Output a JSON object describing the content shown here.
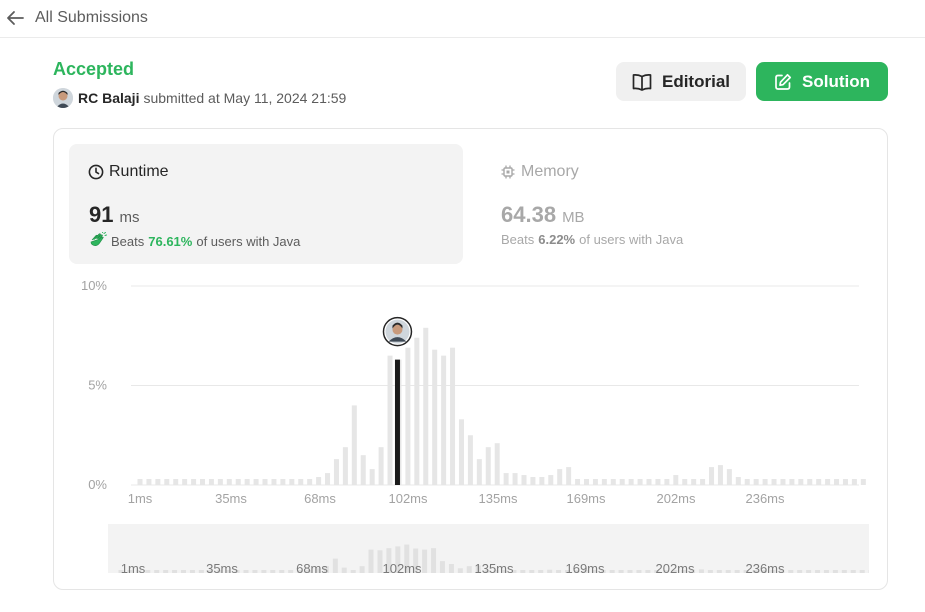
{
  "nav": {
    "back_label": "All Submissions"
  },
  "submission": {
    "status": "Accepted",
    "author": "RC Balaji",
    "submitted_text": "submitted at May 11, 2024 21:59"
  },
  "buttons": {
    "editorial": "Editorial",
    "solution": "Solution"
  },
  "runtime": {
    "title": "Runtime",
    "value": "91",
    "unit": "ms",
    "beats_prefix": "Beats",
    "beats_pct": "76.61%",
    "beats_suffix": "of users with Java"
  },
  "memory": {
    "title": "Memory",
    "value": "64.38",
    "unit": "MB",
    "beats_prefix": "Beats",
    "beats_pct": "6.22%",
    "beats_suffix": "of users with Java"
  },
  "colors": {
    "accent_green": "#2db55d",
    "bar_gray": "#e6e6e6",
    "highlight_bar": "#1a1a1a"
  },
  "icons": {
    "back": "arrow-left-icon",
    "editorial": "book-open-icon",
    "solution": "edit-square-icon",
    "runtime": "clock-icon",
    "memory": "chip-icon",
    "beats": "clapping-hands-icon"
  },
  "chart_data": {
    "type": "bar",
    "ylabel": "",
    "ylim": [
      0,
      10
    ],
    "y_ticks": [
      "10%",
      "5%",
      "0%"
    ],
    "x_tick_labels": [
      "1ms",
      "35ms",
      "68ms",
      "102ms",
      "135ms",
      "169ms",
      "202ms",
      "236ms"
    ],
    "highlight": {
      "index": 29,
      "label": "91ms",
      "value": 6.3
    },
    "values": [
      0.3,
      0.3,
      0.3,
      0.3,
      0.3,
      0.3,
      0.3,
      0.3,
      0.3,
      0.3,
      0.3,
      0.3,
      0.3,
      0.3,
      0.3,
      0.3,
      0.3,
      0.3,
      0.3,
      0.3,
      0.4,
      0.6,
      1.3,
      1.9,
      4.0,
      1.5,
      0.8,
      1.9,
      6.5,
      6.3,
      6.9,
      7.4,
      7.9,
      6.8,
      6.5,
      6.9,
      3.3,
      2.5,
      1.3,
      1.9,
      2.1,
      0.6,
      0.6,
      0.5,
      0.4,
      0.4,
      0.5,
      0.8,
      0.9,
      0.3,
      0.3,
      0.3,
      0.3,
      0.3,
      0.3,
      0.3,
      0.3,
      0.3,
      0.3,
      0.3,
      0.5,
      0.3,
      0.3,
      0.3,
      0.9,
      1.0,
      0.8,
      0.4,
      0.3,
      0.3,
      0.3,
      0.3,
      0.3,
      0.3,
      0.3,
      0.3,
      0.3,
      0.3,
      0.3,
      0.3,
      0.3,
      0.3,
      0.3,
      0.3,
      0.3
    ]
  }
}
